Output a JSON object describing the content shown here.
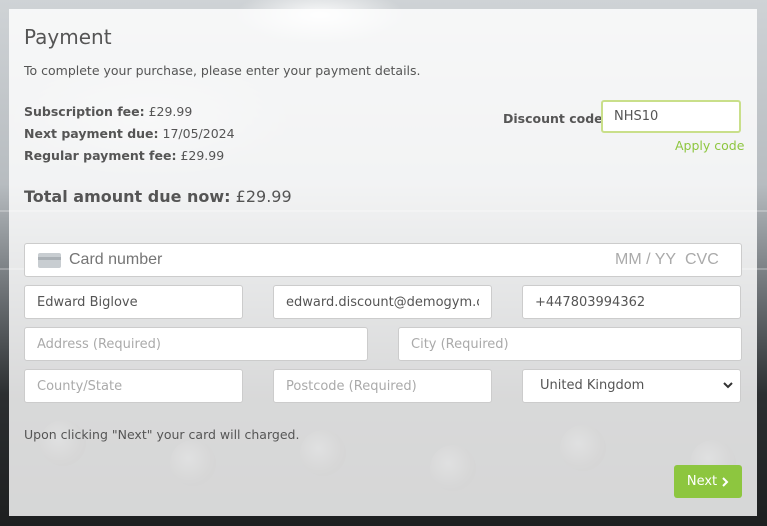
{
  "page": {
    "title": "Payment",
    "subtitle": "To complete your purchase, please enter your payment details."
  },
  "summary": {
    "subscription_label": "Subscription fee:",
    "subscription_value": "£29.99",
    "next_payment_label": "Next payment due:",
    "next_payment_value": "17/05/2024",
    "regular_label": "Regular payment fee:",
    "regular_value": "£29.99",
    "total_label": "Total amount due now:",
    "total_value": "£29.99"
  },
  "discount": {
    "label": "Discount code:",
    "value": "NHS10",
    "apply_label": "Apply code"
  },
  "card": {
    "icon": "credit-card-icon",
    "number_placeholder": "Card number",
    "expiry_placeholder": "MM / YY",
    "cvc_placeholder": "CVC"
  },
  "form": {
    "name_value": "Edward Biglove",
    "email_value": "edward.discount@demogym.co.uk",
    "phone_value": "+447803994362",
    "address_placeholder": "Address (Required)",
    "city_placeholder": "City (Required)",
    "county_placeholder": "County/State",
    "postcode_placeholder": "Postcode (Required)",
    "country_value": "United Kingdom"
  },
  "footer": {
    "note": "Upon clicking \"Next\" your card will charged.",
    "next_label": "Next",
    "next_icon": "chevron-right-icon"
  },
  "colors": {
    "accent": "#8dc63f",
    "discount_border": "#c9df8a",
    "text": "#555555"
  }
}
